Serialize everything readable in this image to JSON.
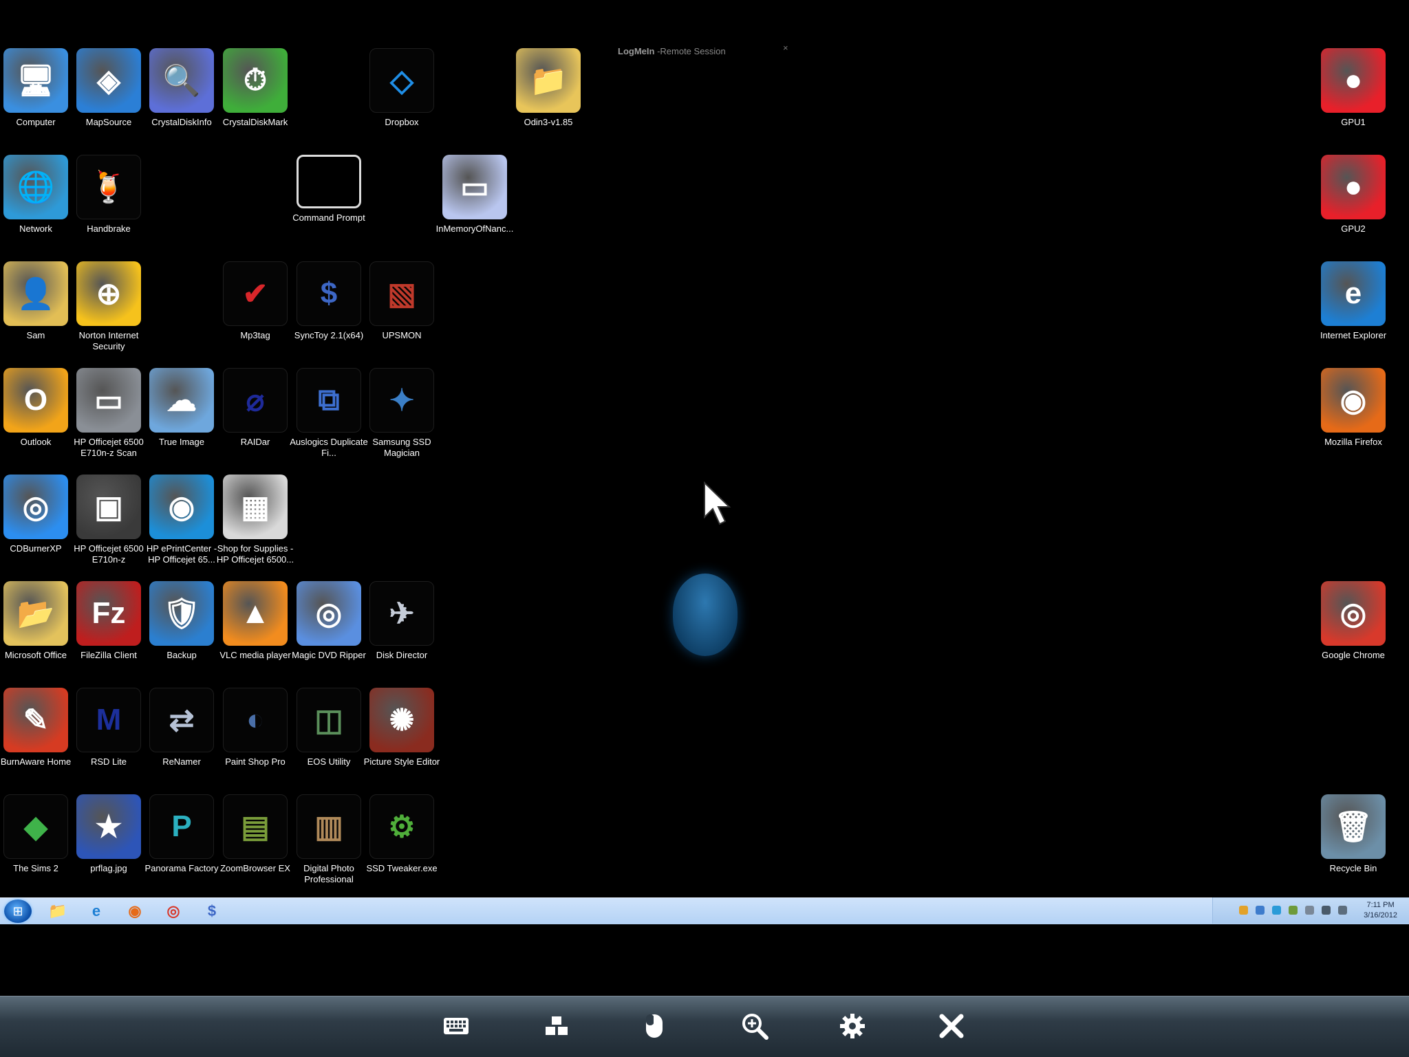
{
  "session": {
    "app": "LogMeIn",
    "title_suffix": "-Remote Session",
    "close": "×"
  },
  "desktop": {
    "icons": [
      {
        "key": "computer",
        "label": "Computer",
        "icon": "computer-icon",
        "color": "#3a8fe0"
      },
      {
        "key": "mapsource",
        "label": "MapSource",
        "icon": "mapsource-icon",
        "color": "#2b7fd6"
      },
      {
        "key": "crystaldiskinfo",
        "label": "CrystalDiskInfo",
        "icon": "crystaldiskinfo-icon",
        "color": "#5d6fd8"
      },
      {
        "key": "crystaldiskmark",
        "label": "CrystalDiskMark",
        "icon": "crystaldiskmark-icon",
        "color": "#3fae3a"
      },
      {
        "key": "dropbox",
        "label": "Dropbox",
        "icon": "dropbox-icon",
        "color": "#1f8ee6"
      },
      {
        "key": "odin",
        "label": "Odin3-v1.85",
        "icon": "folder-icon",
        "color": "#e8c55a"
      },
      {
        "key": "gpu1",
        "label": "GPU1",
        "icon": "gpu-icon",
        "color": "#e8202a"
      },
      {
        "key": "network",
        "label": "Network",
        "icon": "network-globe-icon",
        "color": "#2e9ad8"
      },
      {
        "key": "handbrake",
        "label": "Handbrake",
        "icon": "handbrake-icon",
        "color": "#d57a1d"
      },
      {
        "key": "cmd",
        "label": "Command Prompt",
        "icon": "command-prompt-icon",
        "color": "#111111"
      },
      {
        "key": "inmemory",
        "label": "InMemoryOfNanc...",
        "icon": "video-file-icon",
        "color": "#b9c6ef"
      },
      {
        "key": "gpu2",
        "label": "GPU2",
        "icon": "gpu-icon",
        "color": "#e8202a"
      },
      {
        "key": "sam",
        "label": "Sam",
        "icon": "user-folder-icon",
        "color": "#e2be55"
      },
      {
        "key": "norton",
        "label": "Norton Internet Security",
        "icon": "norton-globe-icon",
        "color": "#f6c21c"
      },
      {
        "key": "mp3tag",
        "label": "Mp3tag",
        "icon": "checkmark-icon",
        "color": "#d8262a"
      },
      {
        "key": "synctoy",
        "label": "SyncToy 2.1(x64)",
        "icon": "synctoy-icon",
        "color": "#3d67c6"
      },
      {
        "key": "upsmon",
        "label": "UPSMON",
        "icon": "upsmon-icon",
        "color": "#c0392b"
      },
      {
        "key": "ie",
        "label": "Internet Explorer",
        "icon": "internet-explorer-icon",
        "color": "#1d7fd4"
      },
      {
        "key": "outlook",
        "label": "Outlook",
        "icon": "outlook-icon",
        "color": "#f2a419"
      },
      {
        "key": "hpscan",
        "label": "HP Officejet 6500 E710n-z Scan",
        "icon": "scanner-icon",
        "color": "#8a8f96"
      },
      {
        "key": "trueimage",
        "label": "True Image",
        "icon": "true-image-icon",
        "color": "#6ea7dd"
      },
      {
        "key": "raidar",
        "label": "RAIDar",
        "icon": "raidar-icon",
        "color": "#1e2a9a"
      },
      {
        "key": "auslogics",
        "label": "Auslogics Duplicate Fi...",
        "icon": "duplicate-finder-icon",
        "color": "#3d6fd0"
      },
      {
        "key": "samsungssd",
        "label": "Samsung SSD Magician",
        "icon": "ssd-magician-icon",
        "color": "#3b7fc7"
      },
      {
        "key": "firefox",
        "label": "Mozilla Firefox",
        "icon": "firefox-icon",
        "color": "#e66a18"
      },
      {
        "key": "cdburner",
        "label": "CDBurnerXP",
        "icon": "cd-burner-icon",
        "color": "#2c8ef0"
      },
      {
        "key": "hpofficejet",
        "label": "HP Officejet 6500 E710n-z",
        "icon": "printer-icon",
        "color": "#3a3a3a"
      },
      {
        "key": "eprint",
        "label": "HP ePrintCenter - HP Officejet 65...",
        "icon": "eprint-icon",
        "color": "#1c8fd9"
      },
      {
        "key": "supplies",
        "label": "Shop for Supplies - HP Officejet 6500...",
        "icon": "printer-supplies-icon",
        "color": "#d9d9d9"
      },
      {
        "key": "msoffice",
        "label": "Microsoft Office",
        "icon": "office-folder-icon",
        "color": "#e3c25c"
      },
      {
        "key": "filezilla",
        "label": "FileZilla Client",
        "icon": "filezilla-icon",
        "color": "#bf1e1e"
      },
      {
        "key": "backup",
        "label": "Backup",
        "icon": "backup-shield-icon",
        "color": "#2b7fd0"
      },
      {
        "key": "vlc",
        "label": "VLC media player",
        "icon": "vlc-cone-icon",
        "color": "#f28c1e"
      },
      {
        "key": "magicdvd",
        "label": "Magic DVD Ripper",
        "icon": "dvd-icon",
        "color": "#5a8fe0"
      },
      {
        "key": "diskdirector",
        "label": "Disk Director",
        "icon": "disk-director-icon",
        "color": "#c5ccd8"
      },
      {
        "key": "chrome",
        "label": "Google Chrome",
        "icon": "chrome-icon",
        "color": "#d8392b"
      },
      {
        "key": "burnaware",
        "label": "BurnAware Home",
        "icon": "burnaware-icon",
        "color": "#d63b22"
      },
      {
        "key": "rsd",
        "label": "RSD Lite",
        "icon": "motorola-icon",
        "color": "#1c2f9c"
      },
      {
        "key": "renamer",
        "label": "ReNamer",
        "icon": "renamer-icon",
        "color": "#b6c2d6"
      },
      {
        "key": "psp",
        "label": "Paint Shop Pro",
        "icon": "paint-shop-icon",
        "color": "#4a6fa8"
      },
      {
        "key": "eos",
        "label": "EOS Utility",
        "icon": "eos-camera-icon",
        "color": "#5b8f5b"
      },
      {
        "key": "pse",
        "label": "Picture Style Editor",
        "icon": "picture-style-icon",
        "color": "#8a2b1f"
      },
      {
        "key": "sims",
        "label": "The Sims 2",
        "icon": "sims-icon",
        "color": "#3fb34a"
      },
      {
        "key": "prflag",
        "label": "prflag.jpg",
        "icon": "flag-image-icon",
        "color": "#2d55b8"
      },
      {
        "key": "panorama",
        "label": "Panorama Factory",
        "icon": "panorama-icon",
        "color": "#2bb0c0"
      },
      {
        "key": "zoombrowser",
        "label": "ZoomBrowser EX",
        "icon": "zoombrowser-icon",
        "color": "#7a9d3a"
      },
      {
        "key": "dpp",
        "label": "Digital Photo Professional",
        "icon": "dpp-icon",
        "color": "#b08a5a"
      },
      {
        "key": "ssdtweaker",
        "label": "SSD Tweaker.exe",
        "icon": "ssd-tweaker-icon",
        "color": "#4fae3a"
      },
      {
        "key": "recycle",
        "label": "Recycle Bin",
        "icon": "recycle-bin-icon",
        "color": "#6c8fa8"
      }
    ]
  },
  "taskbar": {
    "start": {
      "icon": "windows-start-icon",
      "glyph": "⊞"
    },
    "pinned": [
      {
        "name": "explorer-taskbar-button",
        "icon": "folder-icon",
        "glyph": "📁"
      },
      {
        "name": "ie-taskbar-button",
        "icon": "internet-explorer-icon",
        "glyph": "e"
      },
      {
        "name": "firefox-taskbar-button",
        "icon": "firefox-icon",
        "glyph": "◉"
      },
      {
        "name": "chrome-taskbar-button",
        "icon": "chrome-icon",
        "glyph": "◎"
      },
      {
        "name": "synctoy-taskbar-button",
        "icon": "synctoy-icon",
        "glyph": "$"
      }
    ],
    "clock": {
      "time": "7:11 PM",
      "date": "3/16/2012"
    }
  },
  "remote_toolbar": [
    {
      "name": "keyboard-button",
      "icon": "keyboard-icon"
    },
    {
      "name": "screens-button",
      "icon": "screens-icon"
    },
    {
      "name": "mouse-button",
      "icon": "mouse-icon"
    },
    {
      "name": "zoom-button",
      "icon": "zoom-icon"
    },
    {
      "name": "settings-button",
      "icon": "gear-icon"
    },
    {
      "name": "close-session-button",
      "icon": "close-icon"
    }
  ]
}
